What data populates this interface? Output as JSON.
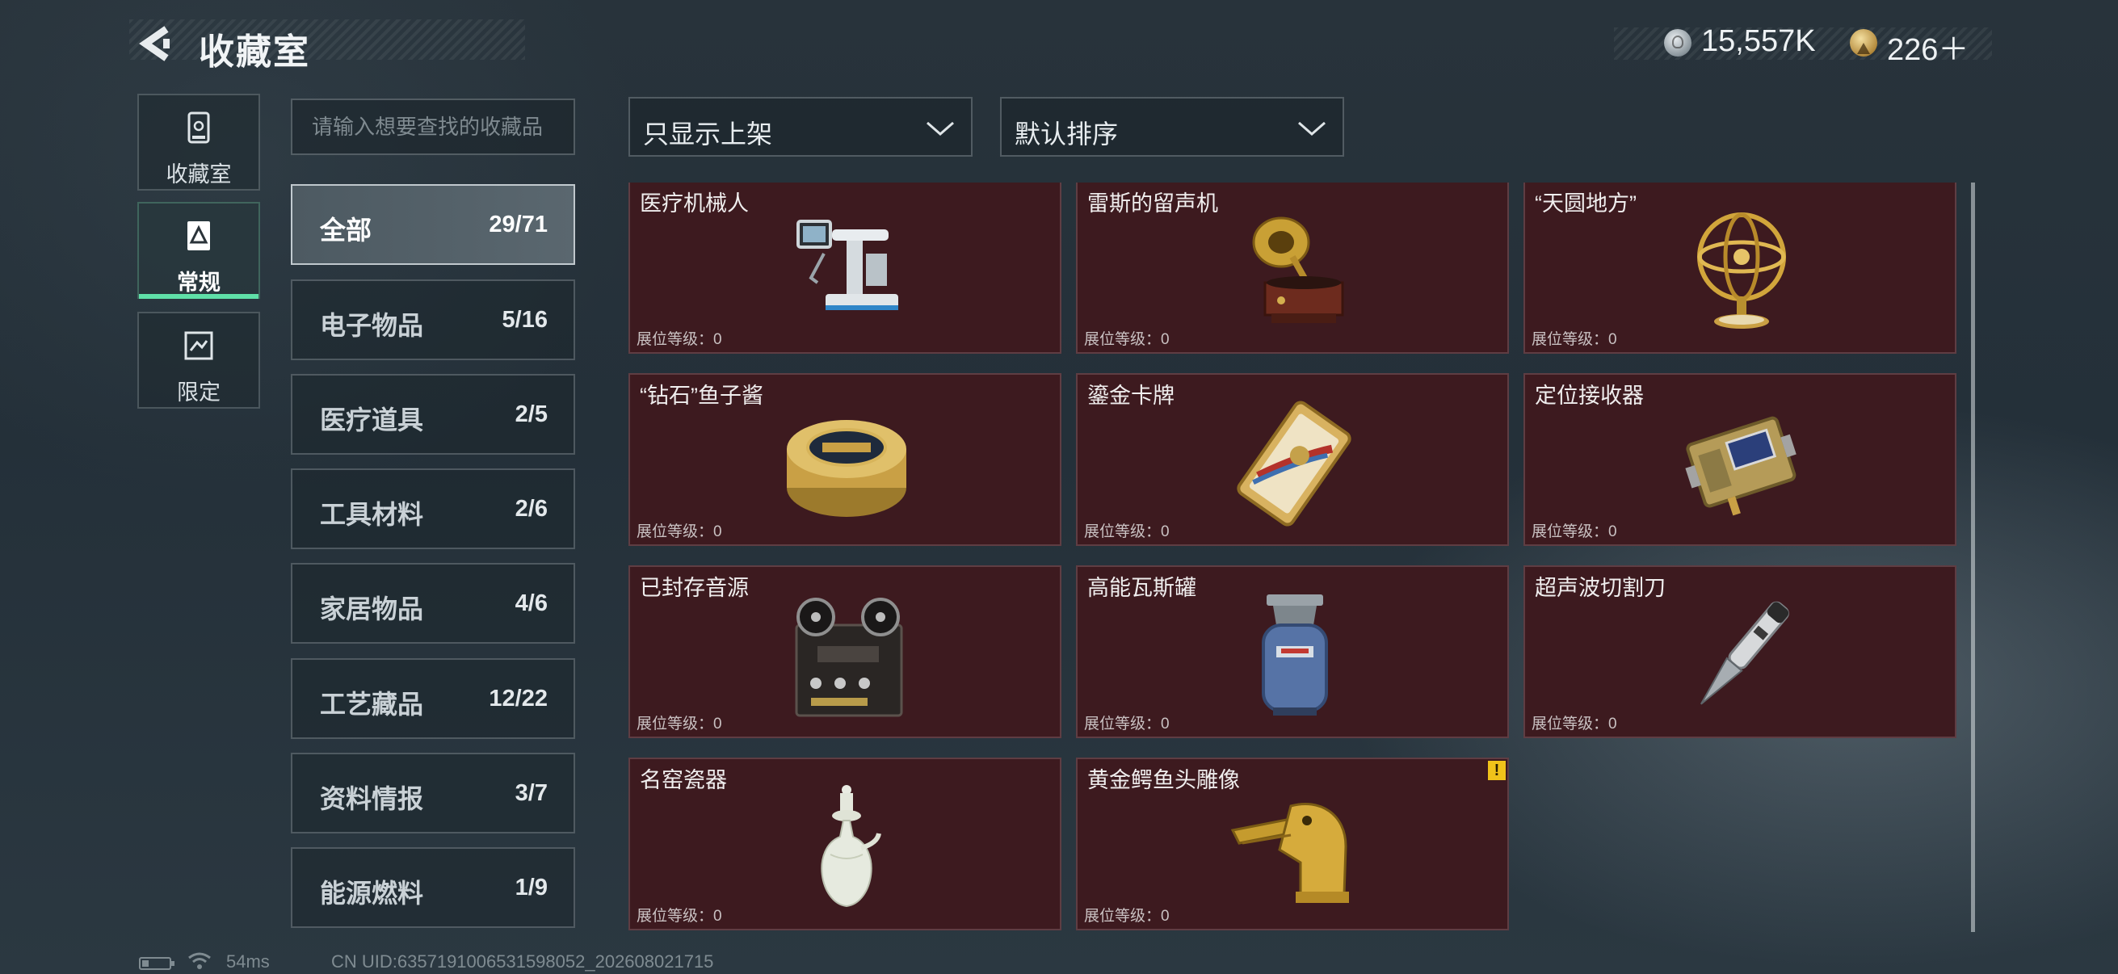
{
  "header": {
    "title": "收藏室",
    "back_icon": "back-arrow-icon"
  },
  "currency": {
    "silver_icon": "silver-coin-icon",
    "silver_amount": "15,557K",
    "gold_icon": "gold-coin-icon",
    "gold_amount": "226＋"
  },
  "side_tabs": [
    {
      "label": "收藏室",
      "icon": "collection-room-icon",
      "active": false
    },
    {
      "label": "常规",
      "icon": "regular-icon",
      "active": true
    },
    {
      "label": "限定",
      "icon": "limited-icon",
      "active": false
    }
  ],
  "search": {
    "placeholder": "请输入想要查找的收藏品",
    "value": ""
  },
  "filters": {
    "filter_label": "只显示上架",
    "sort_label": "默认排序"
  },
  "categories": [
    {
      "name": "全部",
      "count": "29/71",
      "active": true
    },
    {
      "name": "电子物品",
      "count": "5/16"
    },
    {
      "name": "医疗道具",
      "count": "2/5"
    },
    {
      "name": "工具材料",
      "count": "2/6"
    },
    {
      "name": "家居物品",
      "count": "4/6"
    },
    {
      "name": "工艺藏品",
      "count": "12/22"
    },
    {
      "name": "资料情报",
      "count": "3/7"
    },
    {
      "name": "能源燃料",
      "count": "1/9"
    }
  ],
  "items": [
    {
      "name": "医疗机械人",
      "level": "展位等级：0",
      "art": "medical-robot"
    },
    {
      "name": "雷斯的留声机",
      "level": "展位等级：0",
      "art": "gramophone"
    },
    {
      "name": "“天圆地方”",
      "level": "展位等级：0",
      "art": "armillary-sphere"
    },
    {
      "name": "“钻石”鱼子酱",
      "level": "展位等级：0",
      "art": "caviar-tin"
    },
    {
      "name": "鎏金卡牌",
      "level": "展位等级：0",
      "art": "gilded-card"
    },
    {
      "name": "定位接收器",
      "level": "展位等级：0",
      "art": "locator-receiver"
    },
    {
      "name": "已封存音源",
      "level": "展位等级：0",
      "art": "reel-recorder"
    },
    {
      "name": "高能瓦斯罐",
      "level": "展位等级：0",
      "art": "gas-canister"
    },
    {
      "name": "超声波切割刀",
      "level": "展位等级：0",
      "art": "ultrasonic-cutter"
    },
    {
      "name": "名窑瓷器",
      "level": "展位等级：0",
      "art": "porcelain-vase"
    },
    {
      "name": "黄金鳄鱼头雕像",
      "level": "展位等级：0",
      "art": "gold-crocodile-statue",
      "warning": "!"
    }
  ],
  "status": {
    "battery_icon": "battery-icon",
    "wifi_icon": "wifi-icon",
    "ping": "54ms",
    "uid": "CN UID:6357191006531598052_202608021715"
  },
  "colors": {
    "accent": "#5fe0a8",
    "card_bg": "#3d1a1f",
    "warning": "#f0c21a"
  }
}
